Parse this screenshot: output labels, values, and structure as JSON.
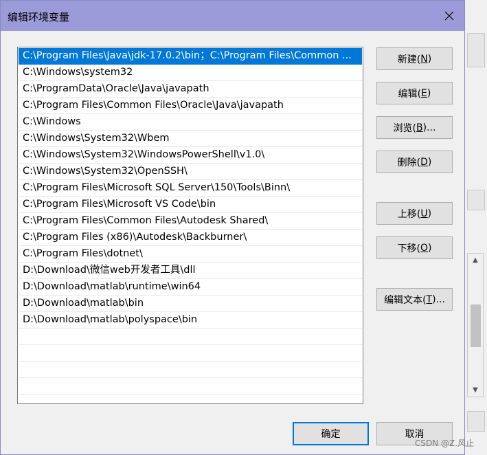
{
  "dialog": {
    "title": "编辑环境变量",
    "close_glyph": "✕"
  },
  "paths": [
    "C:\\Program Files\\Java\\jdk-17.0.2\\bin；C:\\Program Files\\Common ...",
    "C:\\Windows\\system32",
    "C:\\ProgramData\\Oracle\\Java\\javapath",
    "C:\\Program Files\\Common Files\\Oracle\\Java\\javapath",
    "C:\\Windows",
    "C:\\Windows\\System32\\Wbem",
    "C:\\Windows\\System32\\WindowsPowerShell\\v1.0\\",
    "C:\\Windows\\System32\\OpenSSH\\",
    "C:\\Program Files\\Microsoft SQL Server\\150\\Tools\\Binn\\",
    "C:\\Program Files\\Microsoft VS Code\\bin",
    "C:\\Program Files\\Common Files\\Autodesk Shared\\",
    "C:\\Program Files (x86)\\Autodesk\\Backburner\\",
    "C:\\Program Files\\dotnet\\",
    "D:\\Download\\微信web开发者工具\\dll",
    "D:\\Download\\matlab\\runtime\\win64",
    "D:\\Download\\matlab\\bin",
    "D:\\Download\\matlab\\polyspace\\bin"
  ],
  "buttons": {
    "new": {
      "text": "新建(",
      "key": "N",
      "end": ")"
    },
    "edit": {
      "text": "编辑(",
      "key": "E",
      "end": ")"
    },
    "browse": {
      "text": "浏览(",
      "key": "B",
      "end": ")..."
    },
    "delete": {
      "text": "删除(",
      "key": "D",
      "end": ")"
    },
    "move_up": {
      "text": "上移(",
      "key": "U",
      "end": ")"
    },
    "move_down": {
      "text": "下移(",
      "key": "O",
      "end": ")"
    },
    "edit_text": {
      "text": "编辑文本(",
      "key": "T",
      "end": ")..."
    },
    "ok": "确定",
    "cancel": "取消"
  },
  "watermark": "CSDN @Z.风止"
}
